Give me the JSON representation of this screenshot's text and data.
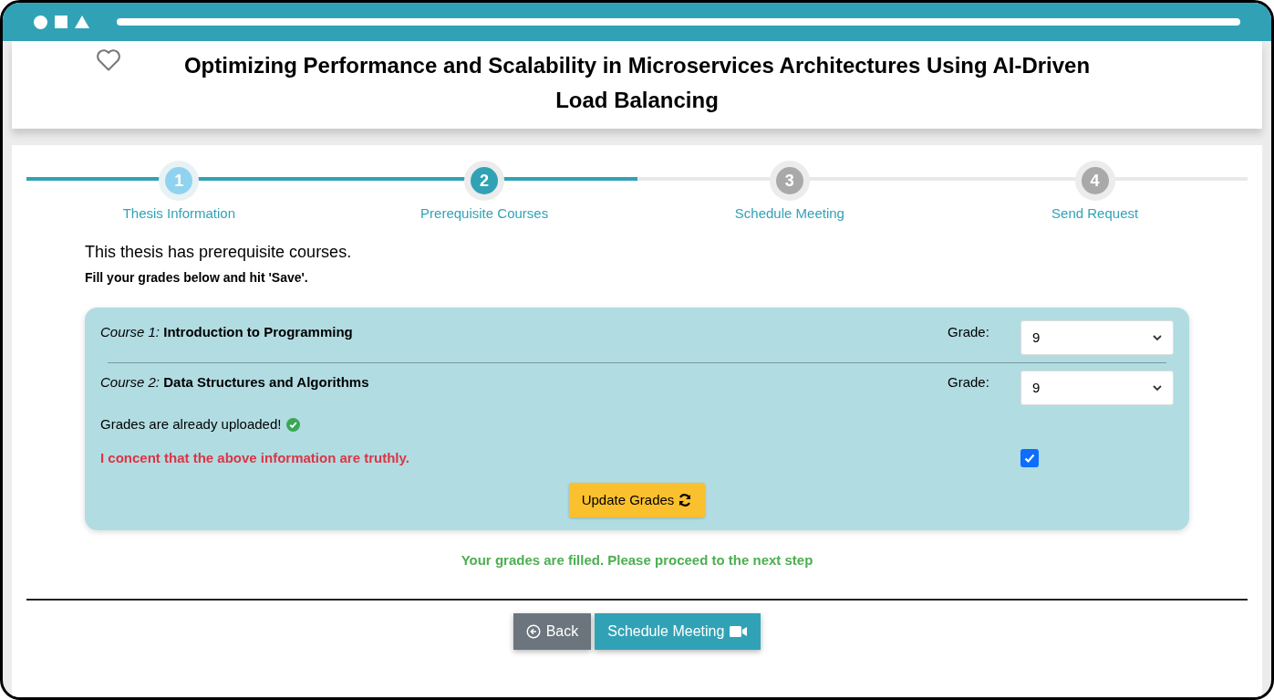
{
  "title": "Optimizing Performance and Scalability in Microservices Architectures Using AI-Driven Load Balancing",
  "favorite": false,
  "steps": [
    {
      "number": "1",
      "label": "Thesis Information",
      "completed": true,
      "selected": false
    },
    {
      "number": "2",
      "label": "Prerequisite Courses",
      "completed": false,
      "selected": true
    },
    {
      "number": "3",
      "label": "Schedule Meeting",
      "completed": false,
      "selected": false
    },
    {
      "number": "4",
      "label": "Send Request",
      "completed": false,
      "selected": false
    }
  ],
  "heading": "This thesis has prerequisite courses.",
  "subheading": "Fill your grades below and hit 'Save'.",
  "courses": [
    {
      "label": "*Course 1:* **Introduction to Programming**",
      "grade_label": "Grade:",
      "grade": "9"
    },
    {
      "label": "*Course 2:* **Data Structures and Algorithms**",
      "grade_label": "Grade:",
      "grade": "9"
    }
  ],
  "uploaded_note": "Grades are already uploaded!",
  "consent": {
    "text": "I concent that the above information are truthly.",
    "checked": true
  },
  "update_button": "Update Grades",
  "status_message": "Your grades are filled. Please proceed to the next step",
  "back_button": "Back",
  "next_button": "Schedule Meeting"
}
